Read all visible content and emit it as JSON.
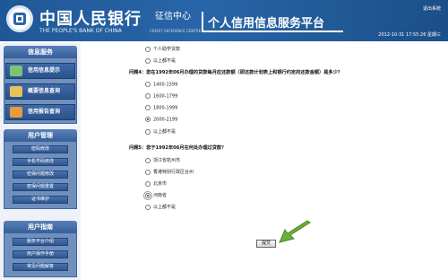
{
  "header": {
    "bank_name_cn": "中国人民银行",
    "center_name_cn": "征信中心",
    "bank_name_en": "THE PEOPLE'S BANK OF CHINA",
    "center_name_en": "CREDIT REFERENCE CENTRE",
    "system_title": "个人信用信息服务平台",
    "logout": "退出系统",
    "datetime": "2012-10-31 17:55:26 星期三"
  },
  "sidebar": {
    "section1_title": "信息服务",
    "info_items": [
      "信用信息提示",
      "概要信息查询",
      "信用报告查询"
    ],
    "section2_title": "用户管理",
    "user_items": [
      "密码修改",
      "手机号码修改",
      "密保问题修改",
      "密保问题重置",
      "证书维护"
    ],
    "section3_title": "用户指南",
    "guide_items": [
      "服务平台介绍",
      "用户操作手册",
      "常见问题解答"
    ]
  },
  "content": {
    "top_options": [
      "个人助学贷款",
      "以上都不是"
    ],
    "q4": {
      "text": "问题4：您在1992年06月办理的贷款每月应还款额（即还款计划表上和银行约定的还款金额）是多少？",
      "options": [
        "1400-1599",
        "1600-1799",
        "1800-1999",
        "2000-2199",
        "以上都不是"
      ],
      "selected_index": 3
    },
    "q5": {
      "text": "问题5：您于1992年06月在何处办理过贷款？",
      "options": [
        "浙江省杭州市",
        "香港特别行政区台州",
        "北京市",
        "河南省",
        "以上都不是"
      ],
      "selected_index": 3
    },
    "confirm_label": "提交"
  },
  "colors": {
    "header_blue": "#2865a8",
    "sidebar_blue": "#2f578f",
    "arrow_green": "#6cae3a"
  }
}
